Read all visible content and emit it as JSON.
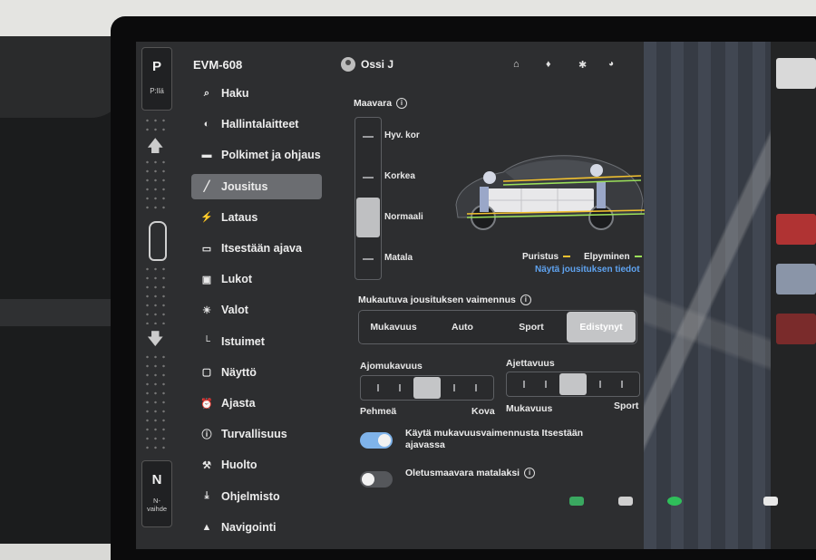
{
  "gear": {
    "park": "P",
    "park_sub": "P:llä",
    "neutral": "N",
    "neutral_sub": "N-vaihde"
  },
  "sidebar": {
    "vehicle_name": "EVM-608",
    "items": [
      {
        "label": "Haku",
        "icon": "search-icon"
      },
      {
        "label": "Hallintalaitteet",
        "icon": "toggle-icon"
      },
      {
        "label": "Polkimet ja ohjaus",
        "icon": "car-icon"
      },
      {
        "label": "Jousitus",
        "icon": "suspension-icon",
        "active": true
      },
      {
        "label": "Lataus",
        "icon": "bolt-icon"
      },
      {
        "label": "Itsestään ajava",
        "icon": "steering-icon"
      },
      {
        "label": "Lukot",
        "icon": "lock-icon"
      },
      {
        "label": "Valot",
        "icon": "light-icon"
      },
      {
        "label": "Istuimet",
        "icon": "seat-icon"
      },
      {
        "label": "Näyttö",
        "icon": "display-icon"
      },
      {
        "label": "Ajasta",
        "icon": "alarm-clock-icon"
      },
      {
        "label": "Turvallisuus",
        "icon": "alert-icon"
      },
      {
        "label": "Huolto",
        "icon": "wrench-icon"
      },
      {
        "label": "Ohjelmisto",
        "icon": "download-icon"
      },
      {
        "label": "Navigointi",
        "icon": "navigation-icon"
      }
    ]
  },
  "header": {
    "user_name": "Ossi J",
    "icons": [
      "home-icon",
      "bell-icon",
      "bluetooth-icon",
      "wifi-icon"
    ]
  },
  "ride_height": {
    "title": "Maavara",
    "options": [
      "Hyv. kor",
      "Korkea",
      "Normaali",
      "Matala"
    ],
    "selected": "Normaali"
  },
  "car_view": {
    "legend": [
      {
        "label": "Puristus",
        "color": "#f2c230"
      },
      {
        "label": "Elpyminen",
        "color": "#9be05a"
      }
    ],
    "details_link": "Näytä jousituksen tiedot"
  },
  "damping": {
    "title": "Mukautuva jousituksen vaimennus",
    "options": [
      "Mukavuus",
      "Auto",
      "Sport",
      "Edistynyt"
    ],
    "selected": "Edistynyt"
  },
  "ride_comfort": {
    "title": "Ajomukavuus",
    "min_label": "Pehmeä",
    "max_label": "Kova",
    "level": 0.5
  },
  "handling": {
    "title": "Ajettavuus",
    "min_label": "Mukavuus",
    "max_label": "Sport",
    "level": 0.5
  },
  "toggles": [
    {
      "label": "Käytä mukavuusvaimennusta Itsestään ajavassa",
      "on": true
    },
    {
      "label": "Oletusmaavara matalaksi",
      "on": false
    }
  ],
  "colors": {
    "accent": "#5fa3f0",
    "toggle_on": "#7fb3ea",
    "active_item": "#6b6d71"
  }
}
